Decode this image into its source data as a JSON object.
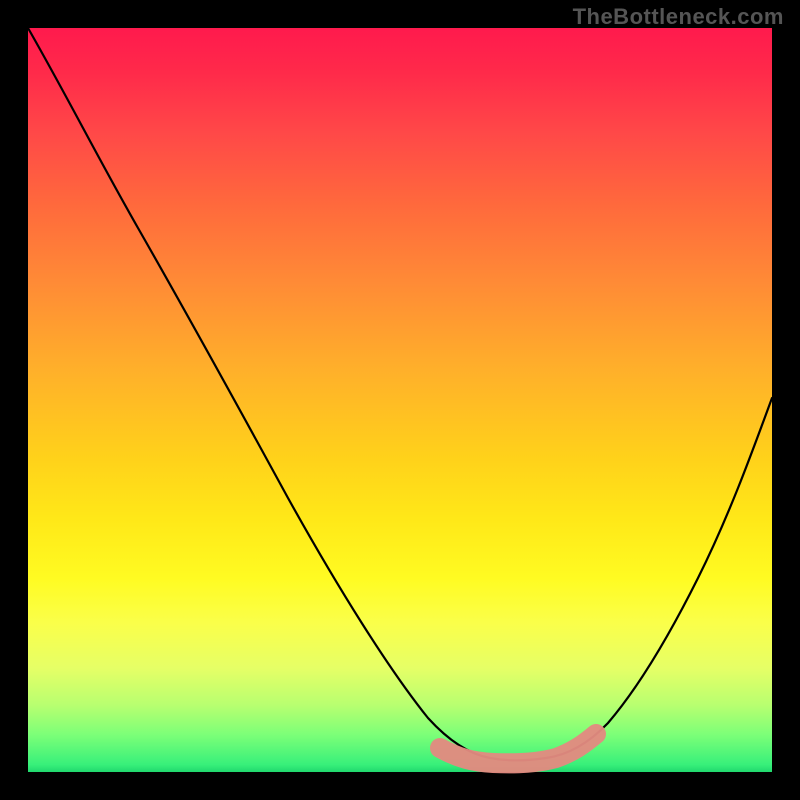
{
  "watermark": "TheBottleneck.com",
  "colors": {
    "background": "#000000",
    "curve": "#000000",
    "flat_zone": "#e28a80",
    "gradient_top": "#ff1a4d",
    "gradient_bottom": "#20d86e"
  },
  "chart_data": {
    "type": "line",
    "title": "",
    "xlabel": "",
    "ylabel": "",
    "xlim": [
      0,
      1
    ],
    "ylim": [
      0,
      1
    ],
    "x": [
      0.0,
      0.05,
      0.1,
      0.15,
      0.2,
      0.25,
      0.3,
      0.35,
      0.4,
      0.45,
      0.5,
      0.55,
      0.57,
      0.6,
      0.63,
      0.66,
      0.69,
      0.72,
      0.76,
      0.8,
      0.85,
      0.9,
      0.95,
      1.0
    ],
    "values": [
      1.0,
      0.9,
      0.8,
      0.71,
      0.62,
      0.54,
      0.46,
      0.38,
      0.3,
      0.22,
      0.15,
      0.08,
      0.05,
      0.03,
      0.02,
      0.02,
      0.02,
      0.02,
      0.03,
      0.06,
      0.12,
      0.22,
      0.35,
      0.5
    ],
    "flat_zone": {
      "x_start": 0.55,
      "x_end": 0.76,
      "y": 0.02
    }
  }
}
